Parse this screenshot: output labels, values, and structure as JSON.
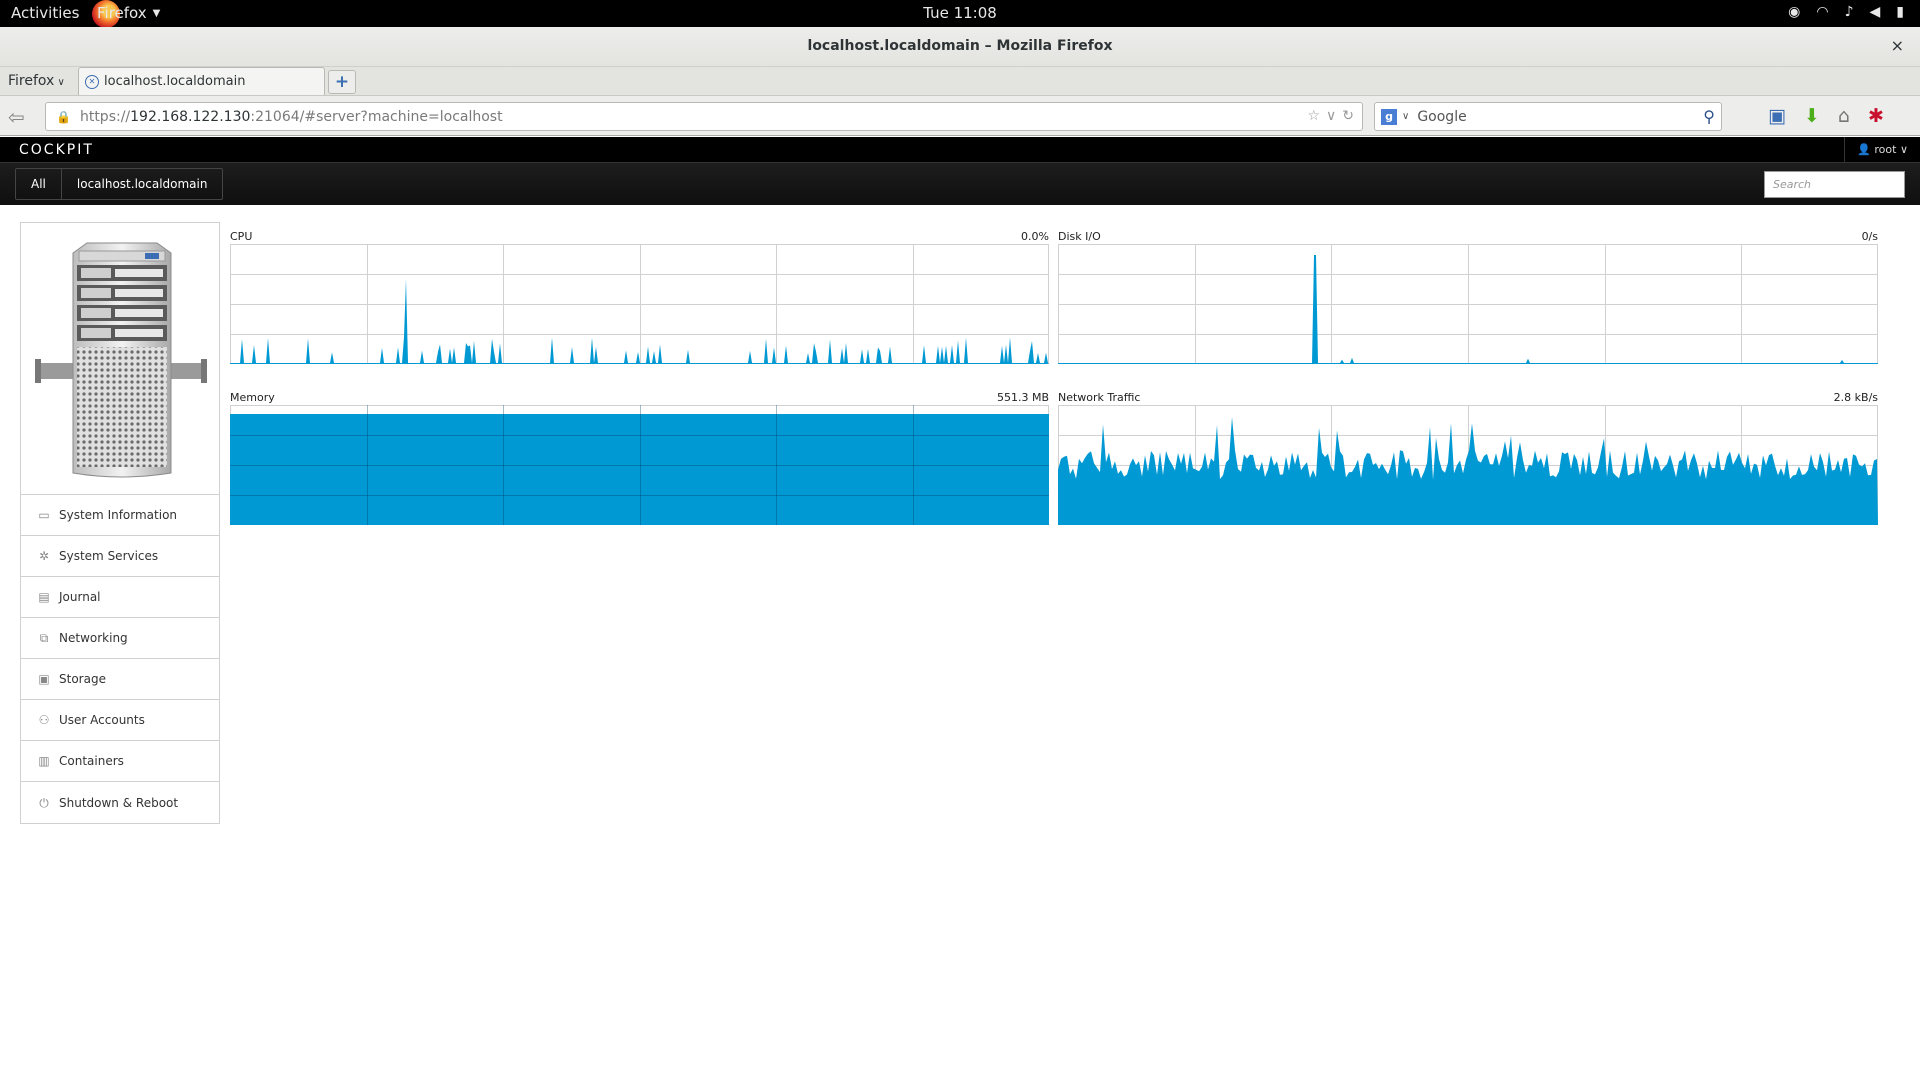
{
  "system": {
    "activities": "Activities",
    "app_menu": "Firefox",
    "clock": "Tue 11:08"
  },
  "window": {
    "title": "localhost.localdomain – Mozilla Firefox",
    "close_glyph": "×"
  },
  "browser": {
    "firefox_menu": "Firefox",
    "tab_title": "localhost.localdomain",
    "url_protocol": "https://",
    "url_host": "192.168.122.130",
    "url_rest": ":21064/#server?machine=localhost",
    "search_placeholder": "Google"
  },
  "cockpit": {
    "brand": "COCKPIT",
    "user": "root",
    "breadcrumb_all": "All",
    "breadcrumb_host": "localhost.localdomain",
    "search_placeholder": "Search",
    "nav": [
      {
        "label": "System Information",
        "icon": "monitor-icon"
      },
      {
        "label": "System Services",
        "icon": "gear-icon"
      },
      {
        "label": "Journal",
        "icon": "journal-icon"
      },
      {
        "label": "Networking",
        "icon": "network-icon"
      },
      {
        "label": "Storage",
        "icon": "storage-icon"
      },
      {
        "label": "User Accounts",
        "icon": "users-icon"
      },
      {
        "label": "Containers",
        "icon": "containers-icon"
      },
      {
        "label": "Shutdown & Reboot",
        "icon": "power-icon"
      }
    ]
  },
  "graphs": {
    "cpu": {
      "label": "CPU",
      "value": "0.0%"
    },
    "disk": {
      "label": "Disk I/O",
      "value": "0/s"
    },
    "memory": {
      "label": "Memory",
      "value": "551.3 MB"
    },
    "network": {
      "label": "Network Traffic",
      "value": "2.8 kB/s"
    }
  },
  "colors": {
    "graph_fill": "#0099d3",
    "graph_grid": "#d1d1d1"
  }
}
